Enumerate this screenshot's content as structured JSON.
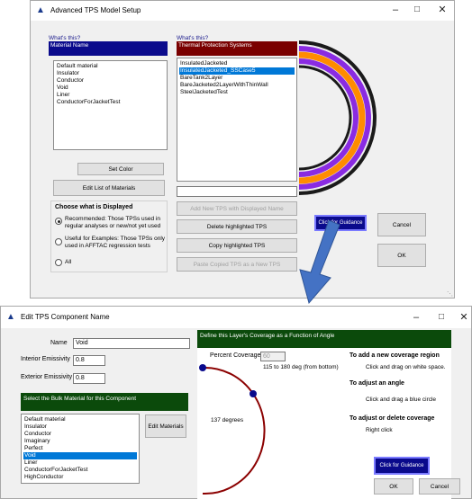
{
  "top_window": {
    "title": "Advanced TPS Model Setup",
    "whats_this_1": "What's this?",
    "material_header": "Material Name",
    "materials": [
      "Default material",
      "Insulator",
      "Conductor",
      "Void",
      "Liner",
      "ConductorForJacketTest"
    ],
    "whats_this_2": "What's this?",
    "tps_header": "Thermal Protection Systems",
    "tps_list": [
      "InsulatedJacketed",
      "InsulatedJacketed_SSCase5",
      "BareTank2Layer",
      "BareJacketed2LayerWithThinWall",
      "SteelJacketedTest"
    ],
    "tps_selected_index": 1,
    "set_color_button": "Set Color",
    "edit_materials_button": "Edit List of Materials",
    "choose_title": "Choose what is Displayed",
    "radio_recommended": "Recommended: Those TPSs used in regular analyses or new/not yet used",
    "radio_useful": "Useful for Examples: Those TPSs only used in AFFTAC regression tests",
    "radio_all": "All",
    "add_new_button": "Add New TPS with Displayed Name",
    "delete_button": "Delete highlighted TPS",
    "copy_button": "Copy highlighted TPS",
    "paste_button": "Paste Copied TPS as a New TPS",
    "guidance_button": "Click for Guidance",
    "cancel_button": "Cancel",
    "ok_button": "OK",
    "ring_colors": [
      "#1a1a1a",
      "#8a2be2",
      "#ff8c00",
      "#8a2be2",
      "#1a1a1a"
    ]
  },
  "bottom_window": {
    "title": "Edit TPS Component Name",
    "name_label": "Name",
    "name_value": "Void",
    "interior_label": "Interior Emissivity",
    "interior_value": "0.8",
    "exterior_label": "Exterior Emissivity",
    "exterior_value": "0.8",
    "bulk_header": "Select the Bulk Material for this Component",
    "bulk_list": [
      "Default material",
      "Insulator",
      "Conductor",
      "Imaginary",
      "Perfect",
      "Void",
      "Liner",
      "ConductorForJacketTest",
      "HighConductor"
    ],
    "bulk_selected_index": 5,
    "edit_materials_button": "Edit Materials",
    "coverage_header": "Define this Layer's Coverage as a Function of Angle",
    "percent_label": "Percent Coverage",
    "percent_value": "60",
    "range_text": "115 to 180 deg (from bottom)",
    "degrees_text": "137 degrees",
    "help_add_title": "To add a new coverage region",
    "help_add_body": "Click and drag on white space.",
    "help_adjust_title": "To adjust an angle",
    "help_adjust_body": "Click and drag a blue circle",
    "help_delete_title": "To adjust or delete coverage",
    "help_delete_body": "Right click",
    "guidance_button": "Click for Guidance",
    "ok_button": "OK",
    "cancel_button": "Cancel"
  }
}
